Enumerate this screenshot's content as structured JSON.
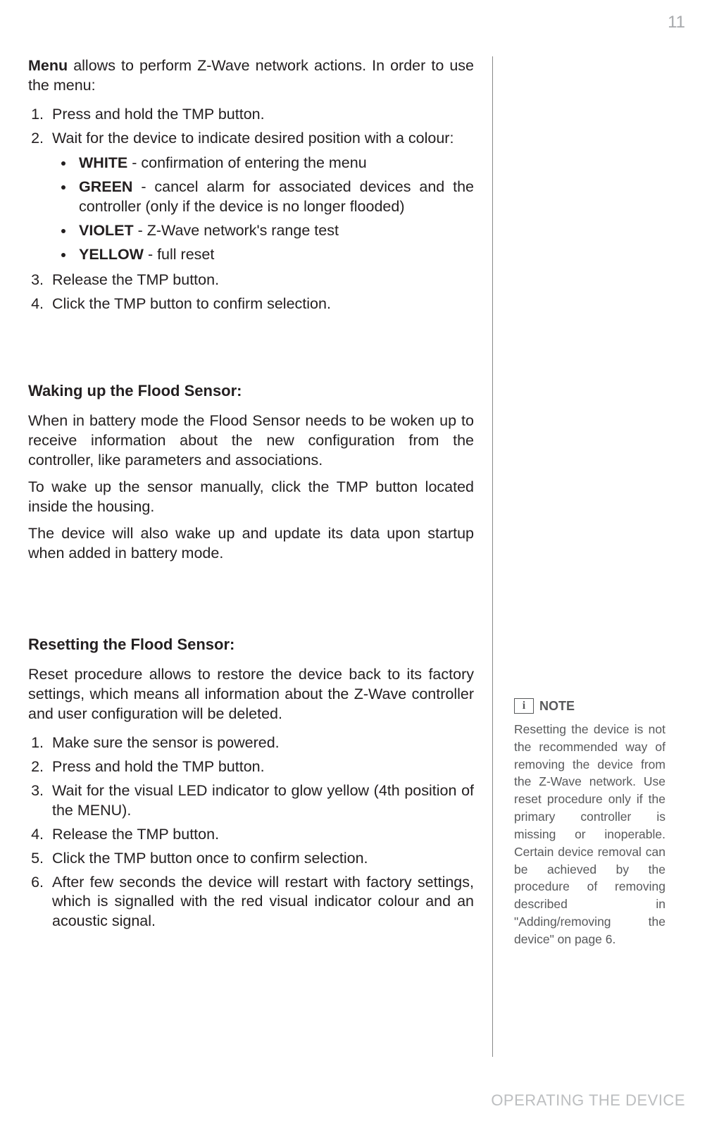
{
  "page_number": "11",
  "footer": "OPERATING THE DEVICE",
  "menu": {
    "intro_bold": "Menu",
    "intro_rest": " allows to perform Z-Wave network actions. In order to use the menu:",
    "steps": {
      "s1": "Press and hold the TMP button.",
      "s2_lead": "Wait for the device to indicate desired position with a colour:",
      "colors": {
        "white_b": "WHITE",
        "white_r": " - confirmation of entering the menu",
        "green_b": "GREEN",
        "green_r": " - cancel alarm for associated devices and the controller (only if the device is no longer flooded)",
        "violet_b": "VIOLET",
        "violet_r": " - Z-Wave network's range test",
        "yellow_b": "YELLOW",
        "yellow_r": " - full reset"
      },
      "s3": "Release the TMP button.",
      "s4": "Click the TMP button to confirm selection."
    }
  },
  "waking": {
    "heading": "Waking up the Flood Sensor:",
    "p1": "When in battery mode the Flood Sensor needs to be woken up to receive information about the new configuration from the controller, like parameters and associations.",
    "p2": "To wake up the sensor manually, click the TMP button located inside the housing.",
    "p3": "The device will also wake up and update its data upon startup when added in battery mode."
  },
  "resetting": {
    "heading": "Resetting the Flood Sensor:",
    "intro": "Reset procedure allows to restore the device back to its factory settings, which means all information about the Z-Wave controller and user configuration will be deleted.",
    "steps": {
      "s1": "Make sure the sensor is powered.",
      "s2": "Press and hold the TMP button.",
      "s3": "Wait for the visual LED indicator to glow yellow (4th position of the MENU).",
      "s4": "Release the TMP button.",
      "s5": "Click the TMP button once to confirm selection.",
      "s6": "After few seconds the device will restart with factory settings, which is signalled with the red visual indicator colour and an acoustic signal."
    }
  },
  "note": {
    "label": "NOTE",
    "icon": "i",
    "body": "Resetting the device is not the recommended way of removing the device from the Z-Wave network. Use reset procedure only if the primary controller is missing or inoperable. Certain device removal can be achieved by the procedure of removing described in \"Adding/removing the device\" on page 6."
  }
}
